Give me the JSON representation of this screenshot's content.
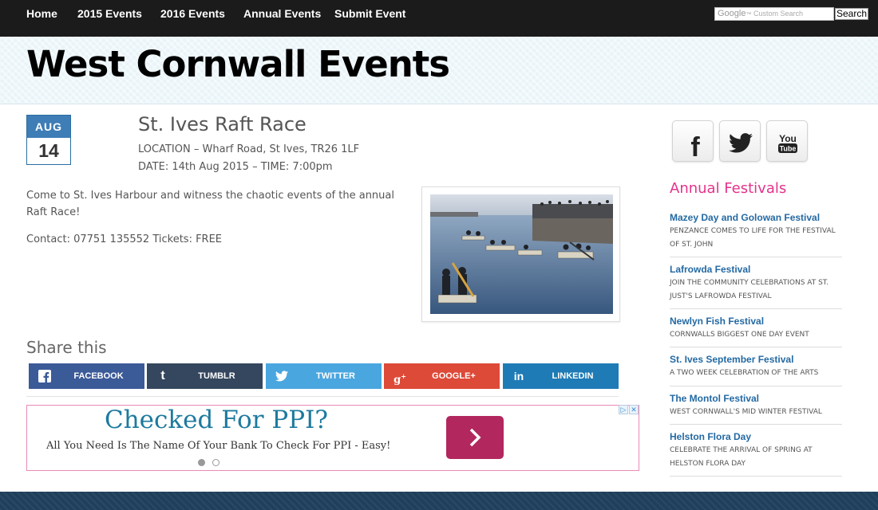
{
  "nav": {
    "items": [
      "Home",
      "2015 Events",
      "2016 Events",
      "Annual Events",
      "Submit Event"
    ],
    "search_placeholder": "Custom Search",
    "search_brand": "Google",
    "search_button": "Search"
  },
  "site": {
    "title": "West Cornwall Events"
  },
  "event": {
    "month": "AUG",
    "day": "14",
    "title": "St. Ives Raft Race",
    "location": "LOCATION – Wharf Road, St Ives, TR26 1LF",
    "datetime": "DATE: 14th Aug 2015 – TIME: 7:00pm",
    "description": "Come to St. Ives Harbour and witness the chaotic events of the annual Raft Race!",
    "contact": "Contact: 07751 135552 Tickets: FREE"
  },
  "share": {
    "title": "Share this",
    "buttons": [
      {
        "label": "FACEBOOK",
        "icon": "facebook-icon",
        "color": "#3b5a98"
      },
      {
        "label": "TUMBLR",
        "icon": "tumblr-icon",
        "color": "#35475e"
      },
      {
        "label": "TWITTER",
        "icon": "twitter-icon",
        "color": "#4aa6df"
      },
      {
        "label": "GOOGLE+",
        "icon": "google-plus-icon",
        "color": "#dd4a38"
      },
      {
        "label": "LINKEDIN",
        "icon": "linkedin-icon",
        "color": "#1f7bb6"
      }
    ]
  },
  "ad": {
    "headline": "Checked For PPI?",
    "subtext": "All You Need Is The Name Of Your Bank To Check For PPI - Easy!"
  },
  "sidebar": {
    "social": [
      {
        "icon": "facebook-icon",
        "glyph": "f"
      },
      {
        "icon": "twitter-icon",
        "glyph": ""
      },
      {
        "icon": "youtube-icon",
        "glyph": "You Tube"
      }
    ],
    "heading": "Annual Festivals",
    "festivals": [
      {
        "title": "Mazey Day and Golowan Festival",
        "desc": "PENZANCE COMES TO LIFE FOR THE FESTIVAL OF ST. JOHN"
      },
      {
        "title": "Lafrowda Festival",
        "desc": "JOIN THE COMMUNITY CELEBRATIONS AT ST. JUST'S LAFROWDA FESTIVAL"
      },
      {
        "title": "Newlyn Fish Festival",
        "desc": "CORNWALLS BIGGEST ONE DAY EVENT"
      },
      {
        "title": "St. Ives September Festival",
        "desc": "A TWO WEEK CELEBRATION OF THE ARTS"
      },
      {
        "title": "The Montol Festival",
        "desc": "WEST CORNWALL'S MID WINTER FESTIVAL"
      },
      {
        "title": "Helston Flora Day",
        "desc": "CELEBRATE THE ARRIVAL OF SPRING AT HELSTON FLORA DAY"
      }
    ]
  },
  "colors": {
    "nav_bg": "#1b1b1b",
    "title_pink": "#e5338a",
    "link_blue": "#2369a3",
    "date_blue": "#3e7db6"
  }
}
